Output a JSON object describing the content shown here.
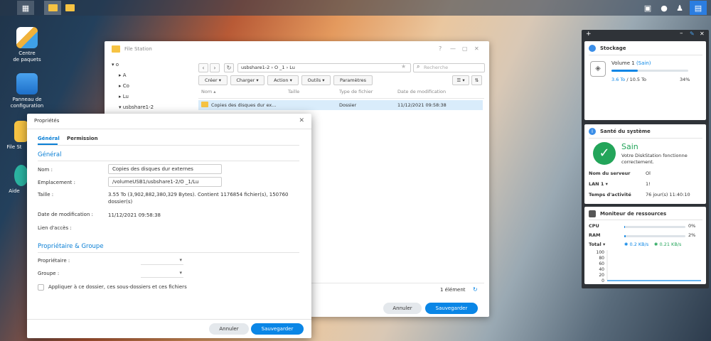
{
  "desktop": {
    "icons": [
      {
        "label1": "Centre",
        "label2": "de paquets"
      },
      {
        "label1": "Panneau de",
        "label2": "configuration"
      },
      {
        "label1": "File St",
        "label2": ""
      },
      {
        "label1": "Aide",
        "label2": ""
      }
    ]
  },
  "file_station": {
    "title": "File Station",
    "tree": [
      "o",
      "A",
      "Co",
      "Lu",
      "usbshare1-2"
    ],
    "path": "usbshare1-2 › O    _1 › Lu",
    "search_placeholder": "Recherche",
    "toolbar": [
      "Créer ▾",
      "Charger ▾",
      "Action ▾",
      "Outils ▾",
      "Paramètres"
    ],
    "columns": [
      "Nom ▴",
      "Taille",
      "Type de fichier",
      "Date de modification"
    ],
    "row": {
      "name": "Copies des disques dur ex...",
      "type": "Dossier",
      "date": "11/12/2021 09:58:38"
    },
    "status_count": "1 élément",
    "cancel": "Annuler",
    "save": "Sauvegarder"
  },
  "dialog": {
    "title": "Propriétés",
    "tabs": [
      "Général",
      "Permission"
    ],
    "section_general": "Général",
    "labels": {
      "name": "Nom :",
      "location": "Emplacement :",
      "size": "Taille :",
      "modified": "Date de modification :",
      "access_link": "Lien d'accès :",
      "owner": "Propriétaire :",
      "group": "Groupe :"
    },
    "values": {
      "name": "Copies des disques dur externes",
      "location": "/volumeUSB1/usbshare1-2/O    _1/Lu",
      "size_line1": "3.55 To (3,902,882,380,329 Bytes). Contient 1176854 fichier(s), 150760",
      "size_line2": "dossier(s)",
      "modified": "11/12/2021 09:58:38"
    },
    "section_owner": "Propriétaire & Groupe",
    "apply_label": "Appliquer à ce dossier, ces sous-dossiers et ces fichiers",
    "cancel": "Annuler",
    "save": "Sauvegarder"
  },
  "widgets": {
    "storage": {
      "title": "Stockage",
      "volume": "Volume 1",
      "status": "(Sain)",
      "used": "3.6 To",
      "total": " / 10.5 To",
      "percent_text": "34%",
      "percent": 34
    },
    "health": {
      "title": "Santé du système",
      "status": "Sain",
      "desc1": "Votre DiskStation fonctionne",
      "desc2": "correctement.",
      "server_label": "Nom du serveur",
      "server_value": "Ol",
      "lan_label": "LAN 1 ▾",
      "lan_value": "1!",
      "uptime_label": "Temps d'activité",
      "uptime_value": "76 jour(s) 11:40:10"
    },
    "resources": {
      "title": "Moniteur de ressources",
      "cpu_label": "CPU",
      "cpu_text": "0%",
      "cpu": 0,
      "ram_label": "RAM",
      "ram_text": "2%",
      "ram": 2,
      "total_label": "Total ▾",
      "up": "0.2 KB/s",
      "down": "0.21 KB/s",
      "ticks": [
        "100",
        "80",
        "60",
        "40",
        "20",
        "0"
      ]
    }
  }
}
